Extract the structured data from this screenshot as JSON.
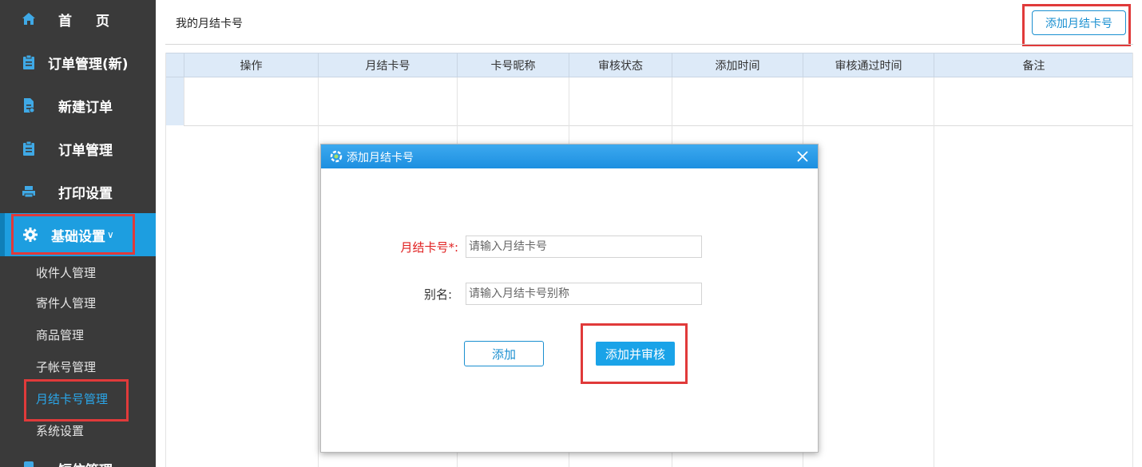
{
  "sidebar": {
    "items": [
      {
        "label": "首页",
        "icon": "home-icon"
      },
      {
        "label": "订单管理(新)",
        "icon": "clipboard-icon"
      },
      {
        "label": "新建订单",
        "icon": "document-add-icon"
      },
      {
        "label": "订单管理",
        "icon": "clipboard-icon"
      },
      {
        "label": "打印设置",
        "icon": "printer-icon"
      },
      {
        "label": "基础设置",
        "icon": "gear-icon",
        "chevron": "∨"
      }
    ],
    "sub_items": [
      "收件人管理",
      "寄件人管理",
      "商品管理",
      "子帐号管理",
      "月结卡号管理",
      "系统设置"
    ],
    "partial_item": "短信管理",
    "active_color": "#1d9ee0"
  },
  "header": {
    "title": "我的月结卡号",
    "add_button": "添加月结卡号"
  },
  "table": {
    "columns": [
      "操作",
      "月结卡号",
      "卡号昵称",
      "审核状态",
      "添加时间",
      "审核通过时间",
      "备注"
    ]
  },
  "modal": {
    "title": "添加月结卡号",
    "card_label": "月结卡号*:",
    "card_placeholder": "请输入月结卡号",
    "alias_label": "别名:",
    "alias_placeholder": "请输入月结卡号别称",
    "add_button": "添加",
    "add_audit_button": "添加并审核"
  },
  "colors": {
    "sidebar_bg": "#3a3a3a",
    "accent": "#1d9ee0",
    "highlight": "#e03a3a",
    "required": "#e02020"
  }
}
